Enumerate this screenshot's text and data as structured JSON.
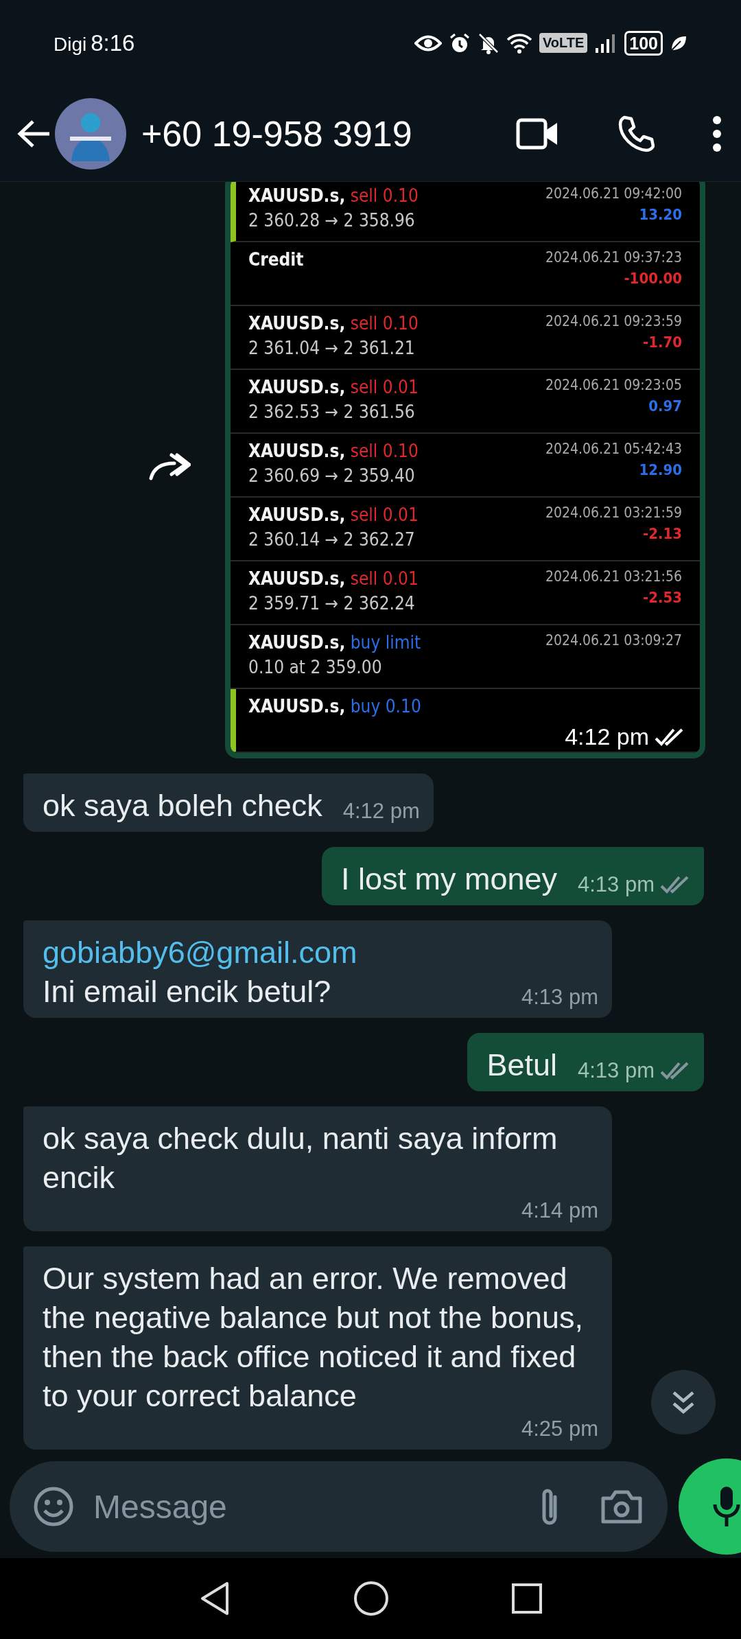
{
  "status_bar": {
    "carrier": "Digi",
    "time": "8:16",
    "network": "VoLTE",
    "battery": "100"
  },
  "header": {
    "title": "+60 19-958 3919"
  },
  "image_message": {
    "time": "4:12 pm",
    "read": false,
    "rows": [
      {
        "kind": "trade",
        "accent": true,
        "symbol": "XAUUSD.s,",
        "action": {
          "text": "sell 0.10",
          "color": "#e0282c"
        },
        "detail": "2 360.28 → 2 358.96",
        "date": "2024.06.21 09:42:00",
        "profit": {
          "text": "13.20",
          "color": "#2a6ee8"
        }
      },
      {
        "kind": "credit",
        "accent": false,
        "symbol": "Credit",
        "date": "2024.06.21 09:37:23",
        "profit": {
          "text": "-100.00",
          "color": "#e0282c"
        }
      },
      {
        "kind": "trade",
        "accent": false,
        "symbol": "XAUUSD.s,",
        "action": {
          "text": "sell 0.10",
          "color": "#e0282c"
        },
        "detail": "2 361.04 → 2 361.21",
        "date": "2024.06.21 09:23:59",
        "profit": {
          "text": "-1.70",
          "color": "#e0282c"
        }
      },
      {
        "kind": "trade",
        "accent": false,
        "symbol": "XAUUSD.s,",
        "action": {
          "text": "sell 0.01",
          "color": "#e0282c"
        },
        "detail": "2 362.53 → 2 361.56",
        "date": "2024.06.21 09:23:05",
        "profit": {
          "text": "0.97",
          "color": "#2a6ee8"
        }
      },
      {
        "kind": "trade",
        "accent": false,
        "symbol": "XAUUSD.s,",
        "action": {
          "text": "sell 0.10",
          "color": "#e0282c"
        },
        "detail": "2 360.69 → 2 359.40",
        "date": "2024.06.21 05:42:43",
        "profit": {
          "text": "12.90",
          "color": "#2a6ee8"
        }
      },
      {
        "kind": "trade",
        "accent": false,
        "symbol": "XAUUSD.s,",
        "action": {
          "text": "sell 0.01",
          "color": "#e0282c"
        },
        "detail": "2 360.14 → 2 362.27",
        "date": "2024.06.21 03:21:59",
        "profit": {
          "text": "-2.13",
          "color": "#e0282c"
        }
      },
      {
        "kind": "trade",
        "accent": false,
        "symbol": "XAUUSD.s,",
        "action": {
          "text": "sell 0.01",
          "color": "#e0282c"
        },
        "detail": "2 359.71 → 2 362.24",
        "date": "2024.06.21 03:21:56",
        "profit": {
          "text": "-2.53",
          "color": "#e0282c"
        }
      },
      {
        "kind": "order",
        "accent": false,
        "symbol": "XAUUSD.s,",
        "action": {
          "text": "buy limit",
          "color": "#2a6ee8"
        },
        "detail": "0.10 at 2 359.00",
        "date": "2024.06.21 03:09:27"
      },
      {
        "kind": "trade",
        "accent": true,
        "symbol": "XAUUSD.s,",
        "action": {
          "text": "buy 0.10",
          "color": "#2a6ee8"
        }
      }
    ]
  },
  "messages": [
    {
      "kind": "incoming",
      "text": "ok saya boleh check",
      "time": "4:12 pm"
    },
    {
      "kind": "outgoing",
      "text": "I lost my money",
      "time": "4:13 pm",
      "read": false
    },
    {
      "kind": "incoming",
      "link": "gobiabby6@gmail.com",
      "text": "Ini email encik betul?",
      "time": "4:13 pm"
    },
    {
      "kind": "outgoing",
      "text": "Betul",
      "time": "4:13 pm",
      "read": false
    },
    {
      "kind": "incoming",
      "text": "ok saya check dulu, nanti saya inform encik",
      "time": "4:14 pm"
    },
    {
      "kind": "incoming",
      "text": "Our system had an error. We removed the negative balance but not the bonus, then the back office noticed it and fixed to your correct balance",
      "time": "4:25 pm"
    }
  ],
  "composer": {
    "placeholder": "Message"
  }
}
